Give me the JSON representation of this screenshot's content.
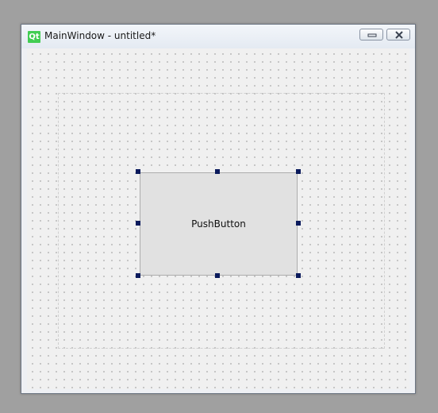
{
  "window": {
    "title": "MainWindow - untitled*",
    "logo_text": "Qt"
  },
  "form": {
    "pushbutton_label": "PushButton",
    "selected": true
  },
  "colors": {
    "logo_green": "#41cd52",
    "handle": "#0a1a5c",
    "button_face": "#e1e1e1",
    "canvas": "#f0f0f0"
  },
  "icons": {
    "logo": "qt-logo-icon",
    "minimize": "minimize-icon",
    "close": "close-icon"
  }
}
